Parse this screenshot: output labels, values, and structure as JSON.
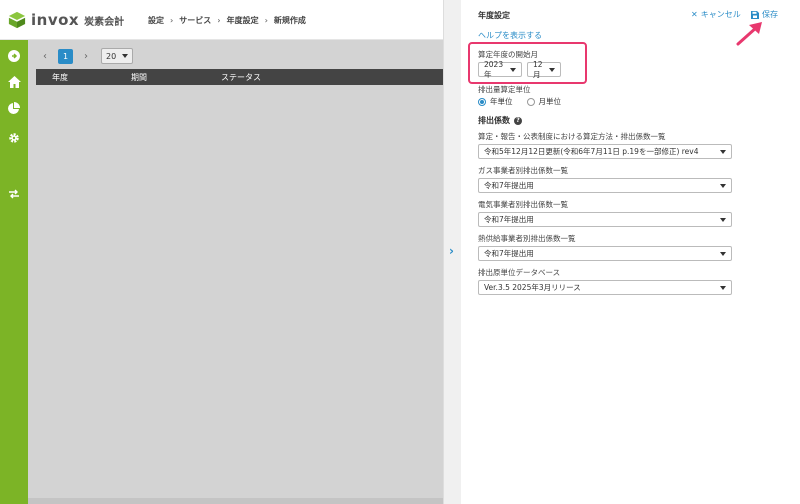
{
  "app": {
    "name": "invox",
    "product": "炭素会計"
  },
  "breadcrumb": [
    "設定",
    "サービス",
    "年度設定",
    "新規作成"
  ],
  "sidebar": {
    "icons": [
      "arrow-circle-icon",
      "home-icon",
      "pie-chart-icon",
      "gear-icon",
      "exchange-icon"
    ]
  },
  "pager": {
    "prev": "‹",
    "page": "1",
    "next": "›",
    "page_size": "20"
  },
  "table": {
    "columns": [
      "年度",
      "期間",
      "ステータス"
    ]
  },
  "panel": {
    "title": "年度設定",
    "cancel_label": "キャンセル",
    "save_label": "保存",
    "help_link": "ヘルプを表示する",
    "start_month_label": "算定年度の開始月",
    "year_value": "2023年",
    "month_value": "12月",
    "unit_label": "排出量算定単位",
    "unit_options": [
      "年単位",
      "月単位"
    ],
    "unit_selected": "年単位",
    "factor_section": "排出係数",
    "fields": [
      {
        "label": "算定・報告・公表制度における算定方法・排出係数一覧",
        "value": "令和5年12月12日更新(令和6年7月11日 p.19を一部修正) rev4"
      },
      {
        "label": "ガス事業者別排出係数一覧",
        "value": "令和7年提出用"
      },
      {
        "label": "電気事業者別排出係数一覧",
        "value": "令和7年提出用"
      },
      {
        "label": "熱供給事業者別排出係数一覧",
        "value": "令和7年提出用"
      },
      {
        "label": "排出原単位データベース",
        "value": "Ver.3.5 2025年3月リリース"
      }
    ]
  },
  "colors": {
    "brand_green": "#7cb426",
    "accent_blue": "#2a8cc7",
    "highlight_pink": "#e8386e"
  }
}
